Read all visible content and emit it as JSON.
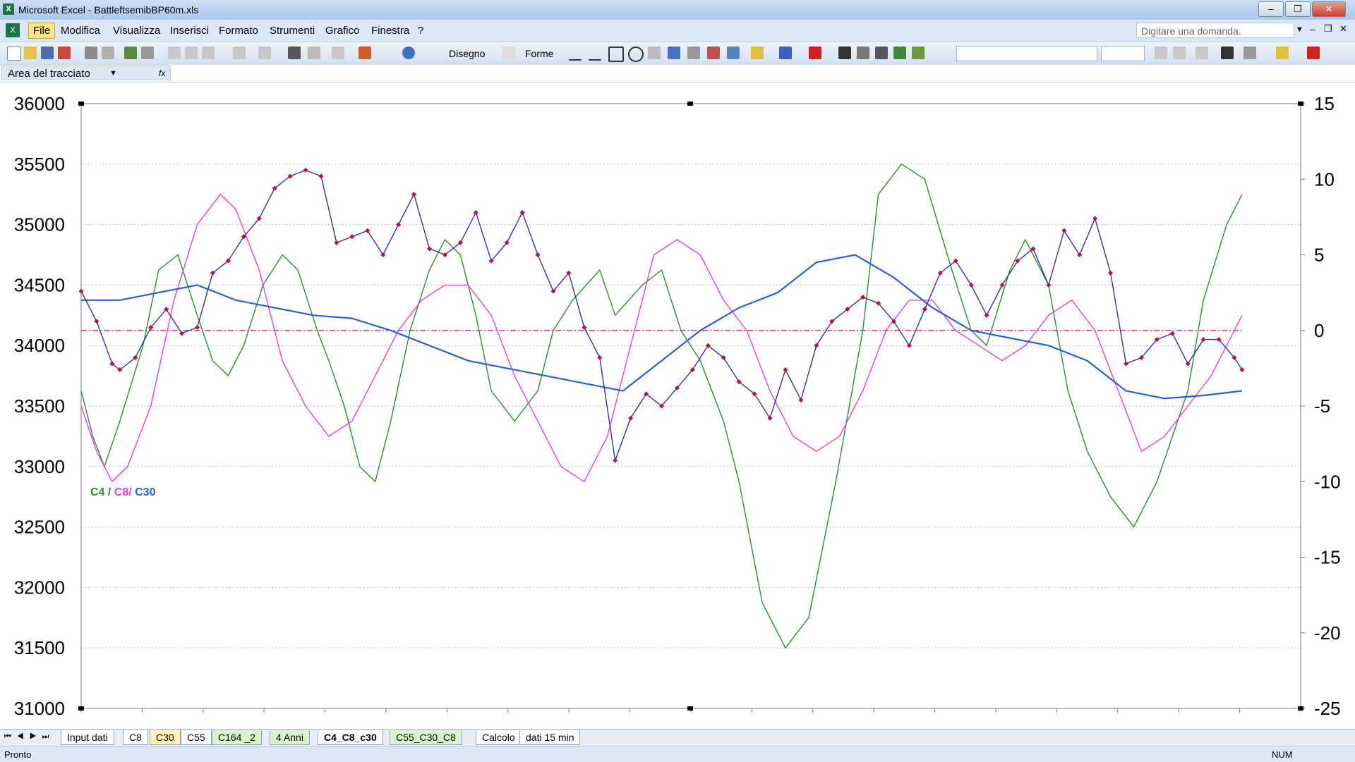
{
  "window": {
    "title": "Microsoft Excel - BattleftsemibBP60m.xls"
  },
  "menu": [
    "File",
    "Modifica",
    "Visualizza",
    "Inserisci",
    "Formato",
    "Strumenti",
    "Grafico",
    "Finestra",
    "?"
  ],
  "ask_placeholder": "Digitare una domanda.",
  "toolbar": {
    "disegno_label": "Disegno",
    "forme_label": "Forme"
  },
  "name_box": "Area del tracciato",
  "formula_icon": "fx-icon",
  "sheet_tabs": [
    {
      "label": "Input dati",
      "style": "normal"
    },
    {
      "label": "C8",
      "style": "normal"
    },
    {
      "label": "C30",
      "style": "yellow"
    },
    {
      "label": "C55",
      "style": "normal"
    },
    {
      "label": "C164 _2",
      "style": "green"
    },
    {
      "label": "4 Anni",
      "style": "green"
    },
    {
      "label": "C4_C8_c30",
      "style": "active"
    },
    {
      "label": "C55_C30_C8",
      "style": "green"
    },
    {
      "label": "Calcolo",
      "style": "normal"
    },
    {
      "label": "dati 15 min",
      "style": "normal"
    }
  ],
  "status": {
    "ready": "Pronto",
    "num": "NUM"
  },
  "legend": {
    "c4": "C4",
    "sep1": " / ",
    "c8": "C8/",
    "c30": " C30"
  },
  "colors": {
    "green": "#2e8b2e",
    "magenta": "#e040e0",
    "blue": "#2a5fd8",
    "price": "#3030b0",
    "marker": "#c0103a",
    "zero": "#a02090"
  },
  "chart_data": {
    "type": "line",
    "title": "",
    "left_axis": {
      "min": 31000,
      "max": 36000,
      "ticks": [
        31000,
        31500,
        32000,
        32500,
        33000,
        33500,
        34000,
        34500,
        35000,
        35500,
        36000
      ]
    },
    "right_axis": {
      "min": -25,
      "max": 15,
      "ticks": [
        -25,
        -20,
        -15,
        -10,
        -5,
        0,
        5,
        10,
        15
      ]
    },
    "series": [
      {
        "name": "C4",
        "axis": "right",
        "color": "#2e8b2e",
        "x": [
          0,
          3,
          6,
          10,
          16,
          20,
          25,
          30,
          34,
          38,
          42,
          47,
          52,
          56,
          61,
          64,
          68,
          72,
          76,
          80,
          85,
          90,
          94,
          98,
          102,
          106,
          112,
          118,
          122,
          127,
          134,
          138,
          145,
          150,
          155,
          160,
          166,
          170,
          176,
          182,
          188,
          195,
          202,
          206,
          212,
          218,
          225,
          230,
          234,
          240,
          244,
          250,
          255,
          260,
          266,
          272,
          278,
          286,
          290,
          296,
          300
        ],
        "values": [
          -4,
          -7,
          -9,
          -6,
          -1,
          4,
          5,
          1,
          -2,
          -3,
          -1,
          3,
          5,
          4,
          0,
          -2,
          -5,
          -9,
          -10,
          -6,
          0,
          4,
          6,
          5,
          1,
          -4,
          -6,
          -4,
          0,
          2,
          4,
          1,
          3,
          4,
          0,
          -2,
          -6,
          -10,
          -18,
          -21,
          -19,
          -10,
          0,
          9,
          11,
          10,
          4,
          0,
          -1,
          4,
          6,
          3,
          -4,
          -8,
          -11,
          -13,
          -10,
          -4,
          2,
          7,
          9
        ]
      },
      {
        "name": "C8",
        "axis": "right",
        "color": "#e040e0",
        "x": [
          0,
          4,
          8,
          12,
          18,
          24,
          30,
          36,
          40,
          46,
          52,
          58,
          64,
          70,
          76,
          82,
          88,
          94,
          100,
          106,
          112,
          118,
          124,
          130,
          136,
          142,
          148,
          154,
          160,
          166,
          172,
          178,
          184,
          190,
          196,
          202,
          208,
          214,
          220,
          226,
          232,
          238,
          244,
          250,
          256,
          262,
          268,
          274,
          280,
          286,
          292,
          300
        ],
        "values": [
          -5,
          -8,
          -10,
          -9,
          -5,
          2,
          7,
          9,
          8,
          4,
          -2,
          -5,
          -7,
          -6,
          -3,
          0,
          2,
          3,
          3,
          1,
          -3,
          -6,
          -9,
          -10,
          -7,
          -1,
          5,
          6,
          5,
          2,
          0,
          -4,
          -7,
          -8,
          -7,
          -4,
          0,
          2,
          2,
          0,
          -1,
          -2,
          -1,
          1,
          2,
          0,
          -4,
          -8,
          -7,
          -5,
          -3,
          1
        ]
      },
      {
        "name": "C30",
        "axis": "right",
        "color": "#2a5fd8",
        "x": [
          0,
          10,
          20,
          30,
          40,
          50,
          60,
          70,
          80,
          90,
          100,
          110,
          120,
          130,
          140,
          150,
          160,
          170,
          180,
          190,
          200,
          210,
          220,
          230,
          240,
          250,
          260,
          270,
          280,
          290,
          300
        ],
        "values": [
          2,
          2,
          2.5,
          3,
          2,
          1.5,
          1,
          0.8,
          0,
          -1,
          -2,
          -2.5,
          -3,
          -3.5,
          -4,
          -2,
          0,
          1.5,
          2.5,
          4.5,
          5,
          3.5,
          1.5,
          0,
          -0.5,
          -1,
          -2,
          -4,
          -4.5,
          -4.3,
          -4
        ]
      },
      {
        "name": "",
        "axis": "left",
        "color": "#3030b0",
        "x": [
          0,
          4,
          8,
          10,
          14,
          18,
          22,
          26,
          30,
          34,
          38,
          42,
          46,
          50,
          54,
          58,
          62,
          66,
          70,
          74,
          78,
          82,
          86,
          90,
          94,
          98,
          102,
          106,
          110,
          114,
          118,
          122,
          126,
          130,
          134,
          138,
          142,
          146,
          150,
          154,
          158,
          162,
          166,
          170,
          174,
          178,
          182,
          186,
          190,
          194,
          198,
          202,
          206,
          210,
          214,
          218,
          222,
          226,
          230,
          234,
          238,
          242,
          246,
          250,
          254,
          258,
          262,
          266,
          270,
          274,
          278,
          282,
          286,
          290,
          294,
          298,
          300
        ],
        "values": [
          34450,
          34200,
          33850,
          33800,
          33900,
          34150,
          34300,
          34100,
          34150,
          34600,
          34700,
          34900,
          35050,
          35300,
          35400,
          35450,
          35400,
          34850,
          34900,
          34950,
          34750,
          35000,
          35250,
          34800,
          34750,
          34850,
          35100,
          34700,
          34850,
          35100,
          34750,
          34450,
          34600,
          34150,
          33900,
          33050,
          33400,
          33600,
          33500,
          33650,
          33800,
          34000,
          33900,
          33700,
          33600,
          33400,
          33800,
          33550,
          34000,
          34200,
          34300,
          34400,
          34350,
          34200,
          34000,
          34300,
          34600,
          34700,
          34500,
          34250,
          34500,
          34700,
          34800,
          34500,
          34950,
          34750,
          35050,
          34600,
          33850,
          33900,
          34050,
          34100,
          33850,
          34050,
          34050,
          33900,
          33800
        ]
      }
    ],
    "zero_line": 0,
    "grid": true
  }
}
